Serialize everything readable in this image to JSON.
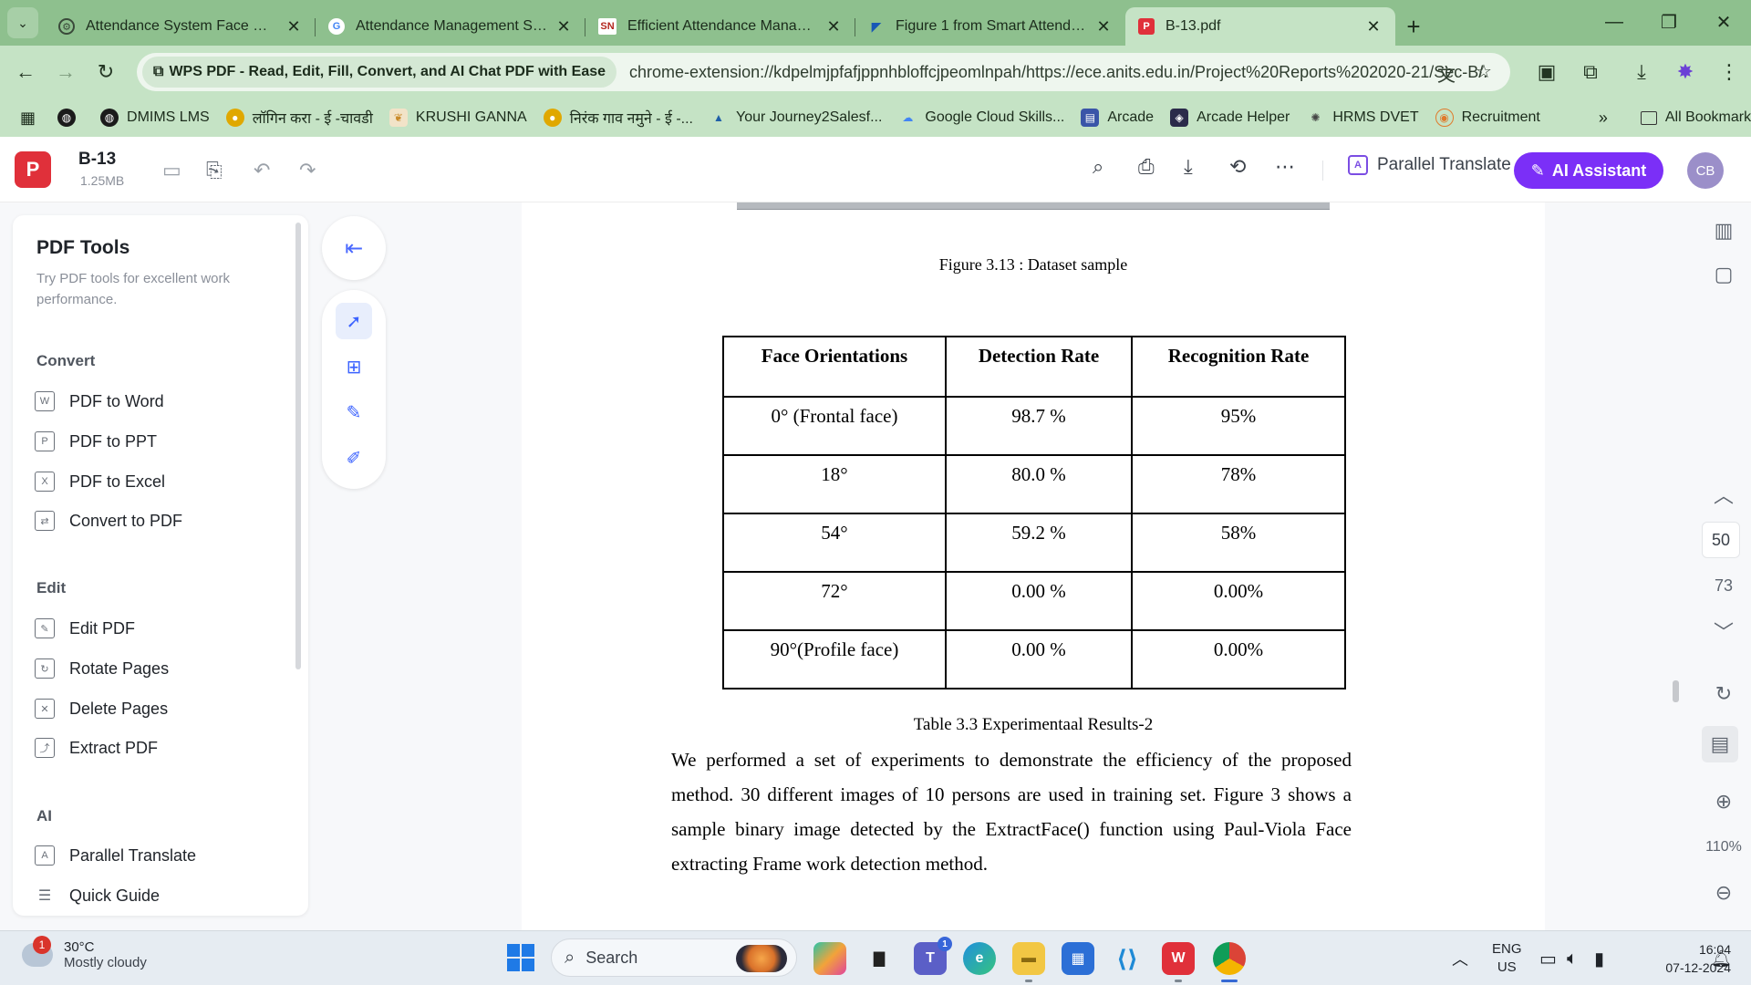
{
  "browser": {
    "tabs": [
      {
        "title": "Attendance System Face Recog",
        "favicon": "chrome-settings-icon",
        "active": false
      },
      {
        "title": "Attendance Management Syste",
        "favicon": "google-icon",
        "active": false
      },
      {
        "title": "Efficient Attendance Managem",
        "favicon": "sn-icon",
        "favicon_text": "SN",
        "active": false
      },
      {
        "title": "Figure 1 from Smart Attendanc",
        "favicon": "semantic-scholar-icon",
        "active": false
      },
      {
        "title": "B-13.pdf",
        "favicon": "wps-pdf-icon",
        "active": true
      }
    ],
    "address": {
      "chip": "WPS PDF - Read, Edit, Fill, Convert, and AI Chat PDF with Ease",
      "url": "chrome-extension://kdpelmjpfafjppnhbloffcjpeomlnpah/https://ece.anits.edu.in/Project%20Reports%202020-21/Sec-B/..."
    },
    "bookmarks": [
      {
        "label": "DMIMS LMS",
        "icon": "globe-icon",
        "color": "#222222"
      },
      {
        "label": "लॉगिन करा - ई -चावडी",
        "icon": "seal-icon",
        "color": "#e0a800"
      },
      {
        "label": "KRUSHI GANNA",
        "icon": "leaf-icon",
        "color": "#c98b2b"
      },
      {
        "label": "निरंक गाव नमुने - ई -...",
        "icon": "seal-icon",
        "color": "#e0a800"
      },
      {
        "label": "Your Journey2Salesf...",
        "icon": "mountain-icon",
        "color": "#1f5fa8"
      },
      {
        "label": "Google Cloud Skills...",
        "icon": "cloud-icon",
        "color": "#4285f4"
      },
      {
        "label": "Arcade",
        "icon": "arcade-icon",
        "color": "#3a55a8"
      },
      {
        "label": "Arcade Helper",
        "icon": "arcade-helper-icon",
        "color": "#2b2b4a"
      },
      {
        "label": "HRMS DVET",
        "icon": "gear-icon",
        "color": "#444444"
      },
      {
        "label": "Recruitment",
        "icon": "badge-icon",
        "color": "#e07a2b"
      }
    ],
    "all_bookmarks": "All Bookmarks"
  },
  "wps": {
    "doc_name": "B-13",
    "doc_size": "1.25MB",
    "parallel_translate": "Parallel Translate",
    "ai_assistant": "AI Assistant",
    "avatar": "CB",
    "brand_color": "#7b2ff7"
  },
  "sidebar": {
    "title": "PDF Tools",
    "subtitle": "Try PDF tools for excellent work performance.",
    "sections": [
      {
        "name": "Convert",
        "items": [
          "PDF to Word",
          "PDF to PPT",
          "PDF to Excel",
          "Convert to PDF"
        ]
      },
      {
        "name": "Edit",
        "items": [
          "Edit PDF",
          "Rotate Pages",
          "Delete Pages",
          "Extract PDF"
        ]
      },
      {
        "name": "AI",
        "items": [
          "Parallel Translate",
          "Quick Guide"
        ]
      }
    ]
  },
  "document": {
    "figure_caption": "Figure 3.13 : Dataset sample",
    "table": {
      "headers": [
        "Face Orientations",
        "Detection Rate",
        "Recognition Rate"
      ],
      "rows": [
        [
          "0°  (Frontal face)",
          "98.7 %",
          "95%"
        ],
        [
          "18°",
          "80.0 %",
          "78%"
        ],
        [
          "54°",
          "59.2 %",
          "58%"
        ],
        [
          "72°",
          "0.00 %",
          "0.00%"
        ],
        [
          "90°(Profile face)",
          "0.00 %",
          "0.00%"
        ]
      ]
    },
    "table_caption": "Table 3.3 Experimentaal Results-2",
    "paragraph": "We performed a set of experiments to demonstrate the efficiency of the proposed method. 30 different images of 10 persons are used in training set. Figure 3 shows a sample binary image detected by the ExtractFace() function using Paul-Viola Face extracting Frame work detection method."
  },
  "right_rail": {
    "current_page": "50",
    "total_pages": "73",
    "zoom": "110%"
  },
  "taskbar": {
    "weather_temp": "30°C",
    "weather_desc": "Mostly cloudy",
    "weather_badge": "1",
    "search": "Search",
    "lang1": "ENG",
    "lang2": "US",
    "time": "16:04",
    "date": "07-12-2024",
    "teams_badge": "1"
  }
}
